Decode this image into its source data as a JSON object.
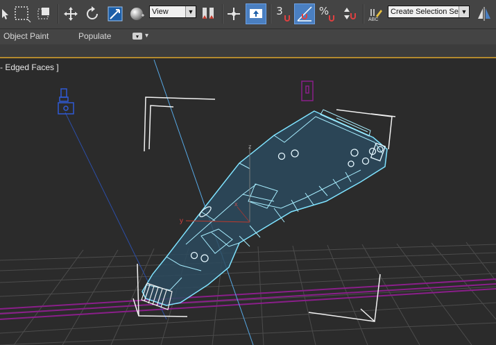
{
  "toolbar": {
    "reference_coordinate": "View",
    "snap_angle_value": "3",
    "snap_percent_symbol": "%",
    "named_selection": "Create Selection Se",
    "abc_label": "ABC"
  },
  "ribbon": {
    "tab_object_paint": "Object Paint",
    "tab_populate": "Populate",
    "options_arrow": "▾"
  },
  "viewport": {
    "label": "- Edged Faces ]",
    "axis_x_label": "x",
    "axis_y_label": "y",
    "axis_z_label": "z"
  },
  "colors": {
    "toolbar_bg": "#444444",
    "active_button": "#4a7fc1",
    "accent_line": "#b38a2e",
    "viewport_bg": "#2b2b2b",
    "selected_wire": "#7fe3ff",
    "grid": "#4c4c4c",
    "grid_highlight": "#8a1f8a"
  }
}
